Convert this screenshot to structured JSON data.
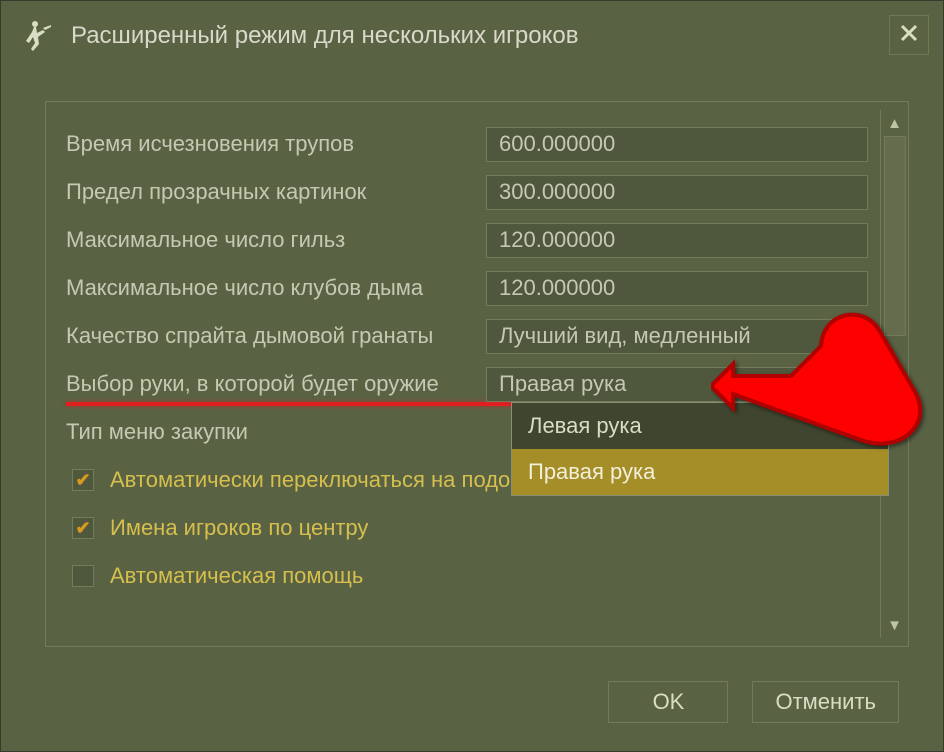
{
  "title": "Расширенный режим для нескольких игроков",
  "rows": [
    {
      "label": "Время исчезновения трупов",
      "value": "600.000000",
      "type": "input"
    },
    {
      "label": "Предел прозрачных картинок",
      "value": "300.000000",
      "type": "input"
    },
    {
      "label": "Максимальное число гильз",
      "value": "120.000000",
      "type": "input"
    },
    {
      "label": "Максимальное число клубов дыма",
      "value": "120.000000",
      "type": "input"
    },
    {
      "label": "Качество спрайта дымовой гранаты",
      "value": "Лучший вид, медленный",
      "type": "select"
    },
    {
      "label": "Выбор руки, в которой будет оружие",
      "value": "Правая рука",
      "type": "select",
      "underline": true
    },
    {
      "label": "Тип меню закупки",
      "value": "",
      "type": "label_only"
    }
  ],
  "dropdown": {
    "options": [
      "Левая рука",
      "Правая рука"
    ],
    "highlighted": 1
  },
  "checks": [
    {
      "label": "Автоматически переключаться на подобранное мощное оружие",
      "checked": true
    },
    {
      "label": "Имена игроков по центру",
      "checked": true
    },
    {
      "label": "Автоматическая помощь",
      "checked": false
    }
  ],
  "buttons": {
    "ok": "OK",
    "cancel": "Отменить"
  }
}
